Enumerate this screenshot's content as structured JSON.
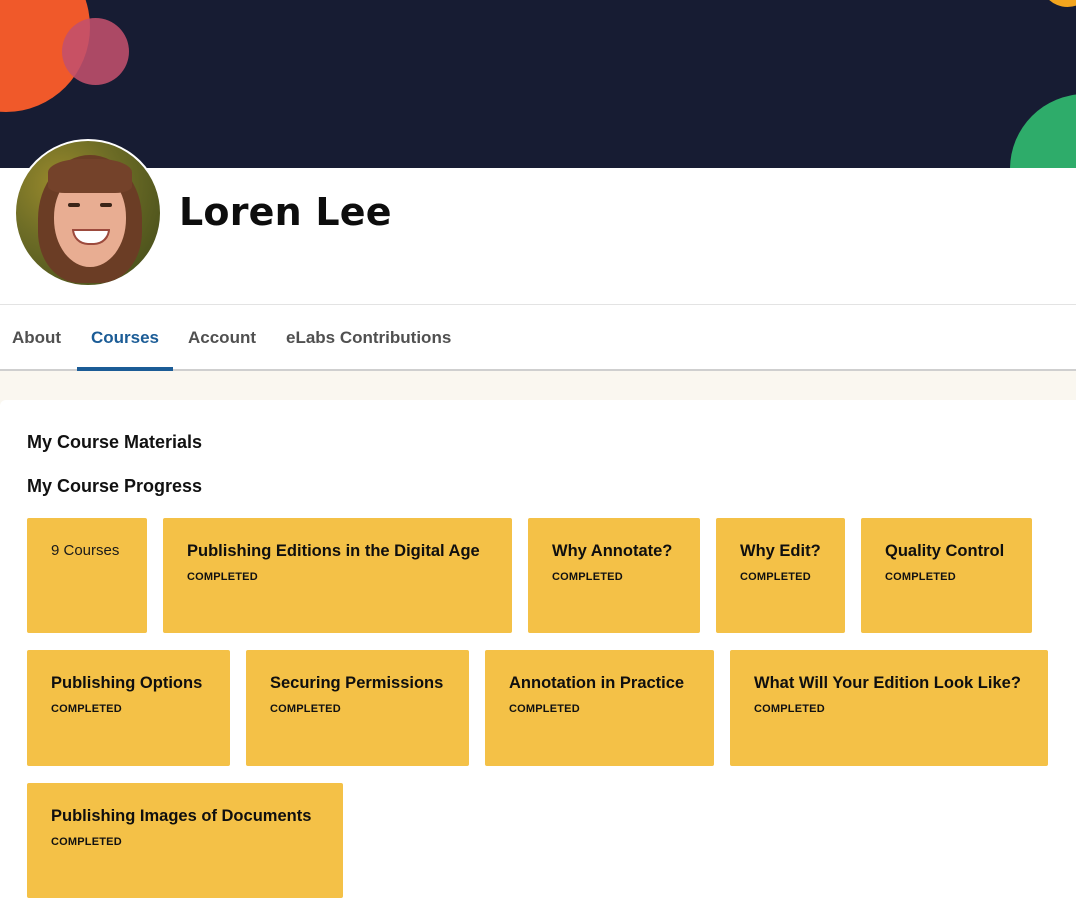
{
  "profile": {
    "name": "Loren Lee"
  },
  "tabs": [
    {
      "label": "About"
    },
    {
      "label": "Courses",
      "active": true
    },
    {
      "label": "Account"
    },
    {
      "label": "eLabs Contributions"
    }
  ],
  "sections": {
    "materials_heading": "My Course Materials",
    "progress_heading": "My Course Progress"
  },
  "progress": {
    "count_label": "9 Courses",
    "courses": [
      {
        "title": "Publishing Editions in the Digital Age",
        "status": "COMPLETED"
      },
      {
        "title": "Why Annotate?",
        "status": "COMPLETED"
      },
      {
        "title": "Why Edit?",
        "status": "COMPLETED"
      },
      {
        "title": "Quality Control",
        "status": "COMPLETED"
      },
      {
        "title": "Publishing Options",
        "status": "COMPLETED"
      },
      {
        "title": "Securing Permissions",
        "status": "COMPLETED"
      },
      {
        "title": "Annotation in Practice",
        "status": "COMPLETED"
      },
      {
        "title": "What Will Your Edition Look Like?",
        "status": "COMPLETED"
      },
      {
        "title": "Publishing Images of Documents",
        "status": "COMPLETED"
      }
    ]
  },
  "colors": {
    "banner": "#171c33",
    "tile": "#f4c147",
    "active_tab": "#1b5c96",
    "accent_orange": "#f0592a",
    "accent_green": "#2eac6a",
    "accent_pink": "#c2506c"
  }
}
